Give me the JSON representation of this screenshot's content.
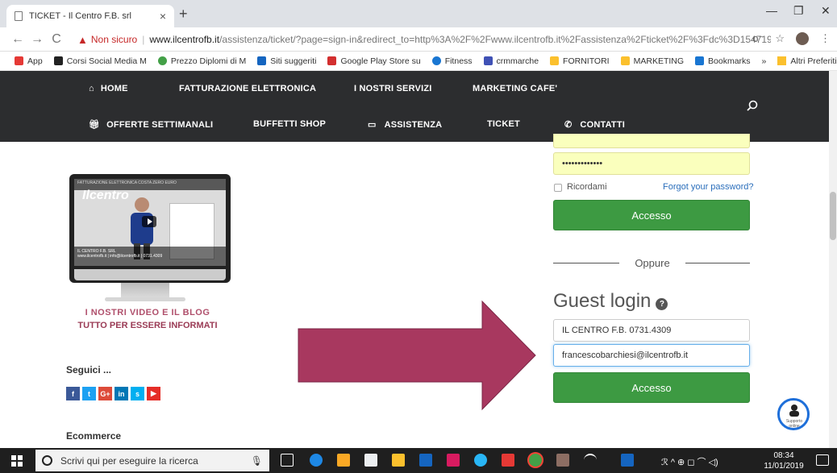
{
  "browser": {
    "tab_title": "TICKET - Il Centro F.B. srl",
    "tab_close": "×",
    "new_tab": "+",
    "minimize": "—",
    "maximize": "❐",
    "close": "✕",
    "back": "←",
    "forward": "→",
    "reload": "C",
    "not_secure": "Non sicuro",
    "url_sep": "|",
    "url_host": "www.ilcentrofb.it",
    "url_rest": "/assistenza/ticket/?page=sign-in&redirect_to=http%3A%2F%2Fwww.ilcentrofb.it%2Fassistenza%2Fticket%2F%3Fdc%3D1547191...",
    "key_icon": "o⁻",
    "star_icon": "☆",
    "menu_icon": "⋮"
  },
  "bookmarks": {
    "items": [
      {
        "label": "App",
        "color": "#e53935"
      },
      {
        "label": "Corsi Social Media M",
        "color": "#222222"
      },
      {
        "label": "Prezzo Diplomi di M",
        "color": "#43a047"
      },
      {
        "label": "Siti suggeriti",
        "color": "#1565c0"
      },
      {
        "label": "Google Play Store su",
        "color": "#d32f2f"
      },
      {
        "label": "Fitness",
        "color": "#1976d2"
      },
      {
        "label": "crmmarche",
        "color": "#3f51b5"
      },
      {
        "label": "FORNITORI",
        "color": "#fbc02d"
      },
      {
        "label": "MARKETING",
        "color": "#fbc02d"
      },
      {
        "label": "Bookmarks",
        "color": "#1976d2"
      }
    ],
    "overflow": "»",
    "other": "Altri Preferiti"
  },
  "nav": {
    "row1": [
      "HOME",
      "FATTURAZIONE ELETTRONICA",
      "I NOSTRI SERVIZI",
      "MARKETING CAFE'"
    ],
    "row2": [
      "OFFERTE SETTIMANALI",
      "BUFFETTI SHOP",
      "ASSISTENZA",
      "TICKET",
      "CONTATTI"
    ]
  },
  "left": {
    "video_top_text": "FATTURAZIONE ELETTRONICA COSTA ZERO EURO",
    "brand": "Ilcentro",
    "video_bottom_line1": "IL CENTRO F.B. SRL",
    "video_bottom_line2": "www.ilcentrofb.it | info@ilcentrofb.it | 0731.4309",
    "video_title": "I NOSTRI VIDEO E IL BLOG",
    "video_sub": "TUTTO PER ESSERE INFORMATI",
    "follow_title": "Seguici ...",
    "social": [
      {
        "label": "f",
        "color": "#3b5998"
      },
      {
        "label": "t",
        "color": "#1da1f2"
      },
      {
        "label": "G+",
        "color": "#dd4b39"
      },
      {
        "label": "in",
        "color": "#0077b5"
      },
      {
        "label": "s",
        "color": "#00aff0"
      },
      {
        "label": "▶",
        "color": "#e52d27"
      }
    ],
    "ecommerce_title": "Ecommerce"
  },
  "login": {
    "password_value": "•••••••••••••",
    "remember_label": "Ricordami",
    "forgot_label": "Forgot your password?",
    "submit_label": "Accesso",
    "or_label": "Oppure",
    "guest_title": "Guest login",
    "help_icon": "?",
    "guest_name_value": "IL CENTRO F.B. 0731.4309",
    "guest_email_value": "francescobarchiesi@ilcentrofb.it",
    "guest_submit_label": "Accesso"
  },
  "chat": {
    "label": "Supporto online"
  },
  "taskbar": {
    "search_placeholder": "Scrivi qui per eseguire la ricerca",
    "time": "08:34",
    "date": "11/01/2019",
    "tray_text": "ℛ  ^  ⊕  ◻  ⌒  ◁)"
  }
}
